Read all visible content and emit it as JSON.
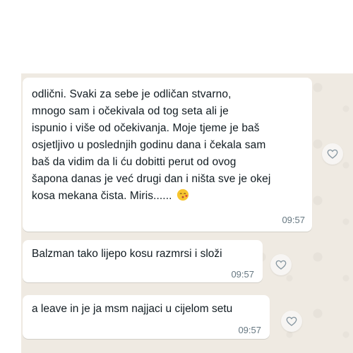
{
  "messages": [
    {
      "lines": [
        "odlični. Svaki za sebe je odličan stvarno,",
        "mnogo sam i očekivala od tog seta ali je",
        "ispunio i više od očekivanja. Moje tjeme je baš",
        "osjetljivo u poslednjih godinu dana i čekala sam",
        "baš da vidim da li ću dobitti perut od ovog",
        "šapona danas je već drugi dan i ništa sve je okej",
        "kosa mekana čista. Miris......"
      ],
      "emoji": "kissing-face-emoji",
      "time": "09:57"
    },
    {
      "text": "Balzman tako lijepo kosu razmrsi i složi",
      "time": "09:57"
    },
    {
      "text": "a leave in je ja msm najjaci u cijelom setu",
      "time": "09:57"
    }
  ],
  "icons": {
    "react": "heart-outline-icon"
  },
  "colors": {
    "chat_background": "#efeae2",
    "bubble": "#ffffff",
    "text": "#111b21",
    "timestamp": "#667781"
  }
}
